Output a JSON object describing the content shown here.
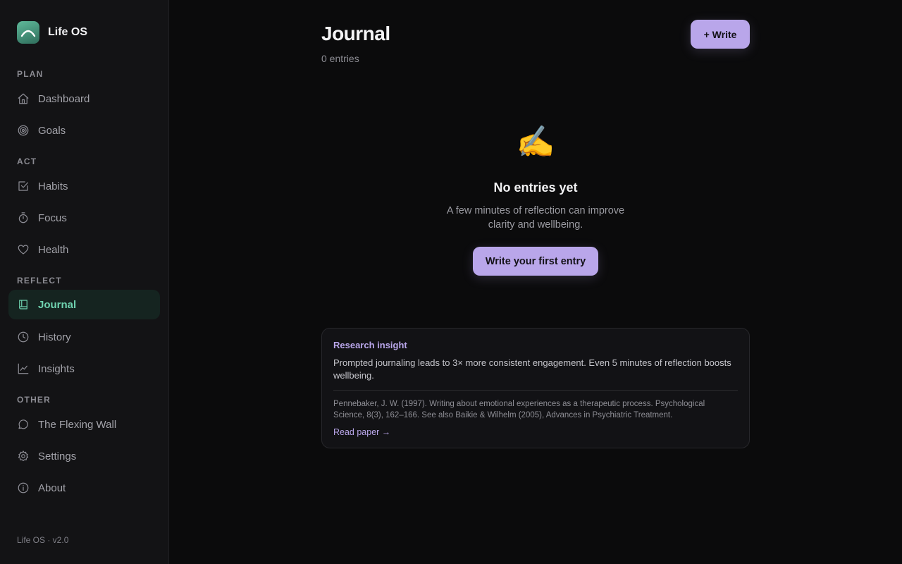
{
  "brand": {
    "name": "Life OS"
  },
  "sidebar": {
    "sections": [
      "PLAN",
      "ACT",
      "REFLECT",
      "OTHER"
    ],
    "items": [
      {
        "label": "Dashboard",
        "icon": "home-icon"
      },
      {
        "label": "Goals",
        "icon": "target-icon"
      },
      {
        "label": "Habits",
        "icon": "checkbox-icon"
      },
      {
        "label": "Focus",
        "icon": "timer-icon"
      },
      {
        "label": "Health",
        "icon": "heart-icon"
      },
      {
        "label": "Journal",
        "icon": "book-icon",
        "active": true
      },
      {
        "label": "History",
        "icon": "clock-icon"
      },
      {
        "label": "Insights",
        "icon": "chart-line-icon"
      },
      {
        "label": "The Flexing Wall",
        "icon": "chat-bubble-icon"
      },
      {
        "label": "Settings",
        "icon": "gear-icon"
      },
      {
        "label": "About",
        "icon": "info-icon"
      }
    ],
    "footer": "Life OS · v2.0"
  },
  "header": {
    "title": "Journal",
    "count": "0 entries",
    "write_label": "+ Write"
  },
  "empty_state": {
    "emoji": "✍️",
    "title": "No entries yet",
    "description": "A few minutes of reflection can improve clarity and wellbeing.",
    "button_label": "Write your first entry"
  },
  "insight": {
    "heading": "Research insight",
    "body": "Prompted journaling leads to 3× more consistent engagement. Even 5 minutes of reflection boosts wellbeing.",
    "citation": "Pennebaker, J. W. (1997). Writing about emotional experiences as a therapeutic process. Psychological Science, 8(3), 162–166. See also Baikie & Wilhelm (2005), Advances in Psychiatric Treatment.",
    "link_label": "Read paper →"
  },
  "colors": {
    "accent_purple": "#b9a6ea",
    "accent_green": "#6fd3b0",
    "background": "#0b0b0c",
    "sidebar": "#131315"
  }
}
